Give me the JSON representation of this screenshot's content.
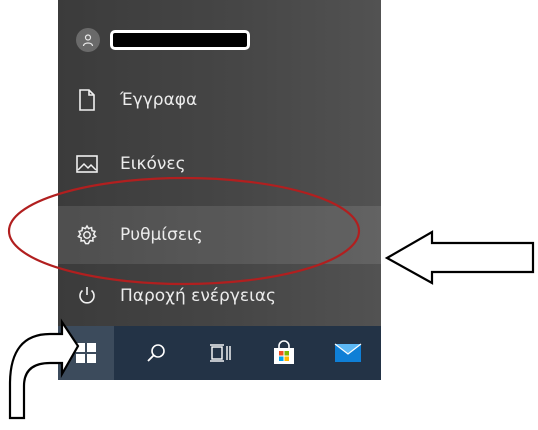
{
  "start_menu": {
    "user": {
      "name_redacted": true
    },
    "items": [
      {
        "label": "Έγγραφα",
        "icon": "document-icon"
      },
      {
        "label": "Εικόνες",
        "icon": "pictures-icon"
      },
      {
        "label": "Ρυθμίσεις",
        "icon": "gear-icon"
      },
      {
        "label": "Παροχή ενέργειας",
        "icon": "power-icon"
      }
    ]
  },
  "taskbar": {
    "buttons": [
      "windows-start-icon",
      "search-icon",
      "task-view-icon",
      "store-icon",
      "mail-icon"
    ]
  },
  "annotations": {
    "highlight_color": "#b11f1f",
    "arrow_color": "#000000"
  }
}
